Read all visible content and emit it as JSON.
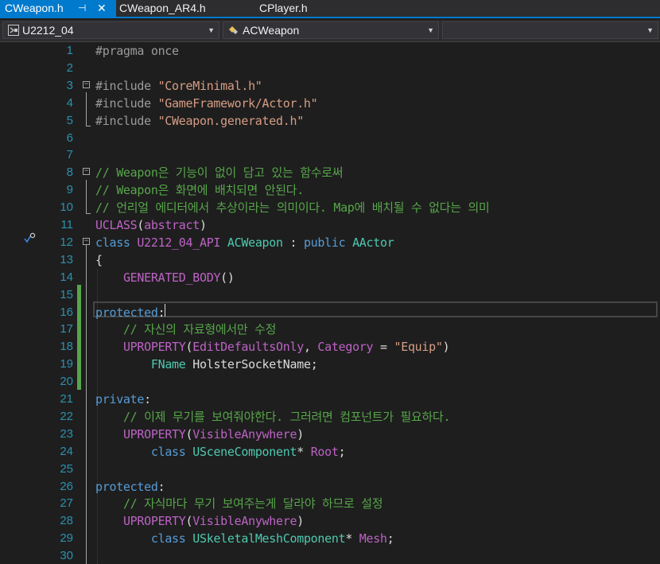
{
  "tabs": [
    {
      "label": "CWeapon.h",
      "active": true,
      "pin": "⊣",
      "close": "✕"
    },
    {
      "label": "CWeapon_AR4.h",
      "active": false
    },
    {
      "label": "CPlayer.h",
      "active": false
    }
  ],
  "nav": {
    "project": "U2212_04",
    "class": "ACWeapon",
    "member": ""
  },
  "editor": {
    "current_line": 16,
    "lines": [
      {
        "n": "1",
        "tokens": [
          [
            "pp",
            "#pragma once"
          ]
        ]
      },
      {
        "n": "2",
        "tokens": []
      },
      {
        "n": "3",
        "tokens": [
          [
            "pp",
            "#include "
          ],
          [
            "str",
            "\"CoreMinimal.h\""
          ]
        ]
      },
      {
        "n": "4",
        "tokens": [
          [
            "pp",
            "#include "
          ],
          [
            "str",
            "\"GameFramework/Actor.h\""
          ]
        ]
      },
      {
        "n": "5",
        "tokens": [
          [
            "pp",
            "#include "
          ],
          [
            "str",
            "\"CWeapon.generated.h\""
          ]
        ]
      },
      {
        "n": "6",
        "tokens": []
      },
      {
        "n": "7",
        "tokens": []
      },
      {
        "n": "8",
        "tokens": [
          [
            "cm",
            "// Weapon은 기능이 없이 담고 있는 함수로써"
          ]
        ]
      },
      {
        "n": "9",
        "tokens": [
          [
            "cm",
            "// Weapon은 화면에 배치되면 안된다."
          ]
        ]
      },
      {
        "n": "10",
        "tokens": [
          [
            "cm",
            "// 언리얼 에디터에서 추상이라는 의미이다. Map에 배치될 수 없다는 의미"
          ]
        ]
      },
      {
        "n": "11",
        "tokens": [
          [
            "mac",
            "UCLASS"
          ],
          [
            "plain",
            "("
          ],
          [
            "mac",
            "abstract"
          ],
          [
            "plain",
            ")"
          ]
        ]
      },
      {
        "n": "12",
        "tokens": [
          [
            "kw",
            "class "
          ],
          [
            "mac",
            "U2212_04_API "
          ],
          [
            "ty",
            "ACWeapon "
          ],
          [
            "plain",
            ": "
          ],
          [
            "kw",
            "public "
          ],
          [
            "ty",
            "AActor"
          ]
        ]
      },
      {
        "n": "13",
        "tokens": [
          [
            "plain",
            "{"
          ]
        ]
      },
      {
        "n": "14",
        "tokens": [
          [
            "plain",
            "    "
          ],
          [
            "mac",
            "GENERATED_BODY"
          ],
          [
            "plain",
            "()"
          ]
        ]
      },
      {
        "n": "15",
        "tokens": []
      },
      {
        "n": "16",
        "tokens": [
          [
            "acc",
            "protected"
          ],
          [
            "plain",
            ":"
          ]
        ]
      },
      {
        "n": "17",
        "tokens": [
          [
            "plain",
            "    "
          ],
          [
            "cm",
            "// 자신의 자료형에서만 수정"
          ]
        ]
      },
      {
        "n": "18",
        "tokens": [
          [
            "plain",
            "    "
          ],
          [
            "mac",
            "UPROPERTY"
          ],
          [
            "plain",
            "("
          ],
          [
            "mac",
            "EditDefaultsOnly"
          ],
          [
            "plain",
            ", "
          ],
          [
            "mac",
            "Category"
          ],
          [
            "plain",
            " = "
          ],
          [
            "str",
            "\"Equip\""
          ],
          [
            "plain",
            ")"
          ]
        ]
      },
      {
        "n": "19",
        "tokens": [
          [
            "plain",
            "        "
          ],
          [
            "ty",
            "FName "
          ],
          [
            "fld",
            "HolsterSocketName"
          ],
          [
            "plain",
            ";"
          ]
        ]
      },
      {
        "n": "20",
        "tokens": []
      },
      {
        "n": "21",
        "tokens": [
          [
            "acc",
            "private"
          ],
          [
            "plain",
            ":"
          ]
        ]
      },
      {
        "n": "22",
        "tokens": [
          [
            "plain",
            "    "
          ],
          [
            "cm",
            "// 이제 무기를 보여줘야한다. 그러려면 컴포넌트가 필요하다."
          ]
        ]
      },
      {
        "n": "23",
        "tokens": [
          [
            "plain",
            "    "
          ],
          [
            "mac",
            "UPROPERTY"
          ],
          [
            "plain",
            "("
          ],
          [
            "mac",
            "VisibleAnywhere"
          ],
          [
            "plain",
            ")"
          ]
        ]
      },
      {
        "n": "24",
        "tokens": [
          [
            "plain",
            "        "
          ],
          [
            "kw",
            "class "
          ],
          [
            "ty",
            "USceneComponent"
          ],
          [
            "plain",
            "* "
          ],
          [
            "mac",
            "Root"
          ],
          [
            "plain",
            ";"
          ]
        ]
      },
      {
        "n": "25",
        "tokens": []
      },
      {
        "n": "26",
        "tokens": [
          [
            "acc",
            "protected"
          ],
          [
            "plain",
            ":"
          ]
        ]
      },
      {
        "n": "27",
        "tokens": [
          [
            "plain",
            "    "
          ],
          [
            "cm",
            "// 자식마다 무기 보여주는게 달라야 하므로 설정"
          ]
        ]
      },
      {
        "n": "28",
        "tokens": [
          [
            "plain",
            "    "
          ],
          [
            "mac",
            "UPROPERTY"
          ],
          [
            "plain",
            "("
          ],
          [
            "mac",
            "VisibleAnywhere"
          ],
          [
            "plain",
            ")"
          ]
        ]
      },
      {
        "n": "29",
        "tokens": [
          [
            "plain",
            "        "
          ],
          [
            "kw",
            "class "
          ],
          [
            "ty",
            "USkeletalMeshComponent"
          ],
          [
            "plain",
            "* "
          ],
          [
            "mac",
            "Mesh"
          ],
          [
            "plain",
            ";"
          ]
        ]
      },
      {
        "n": "30",
        "tokens": []
      }
    ]
  },
  "colors": {
    "accent": "#007acc",
    "line_number": "#2b91af",
    "comment": "#57a64a",
    "string": "#d69d85",
    "keyword": "#569cd6",
    "type": "#4ec9b0",
    "macro": "#bd63c5",
    "change_bar": "#57a64a"
  },
  "icons": {
    "project_icon": "project-icon",
    "class_icon": "class-icon",
    "quick_action_icon": "screwdriver-icon"
  }
}
